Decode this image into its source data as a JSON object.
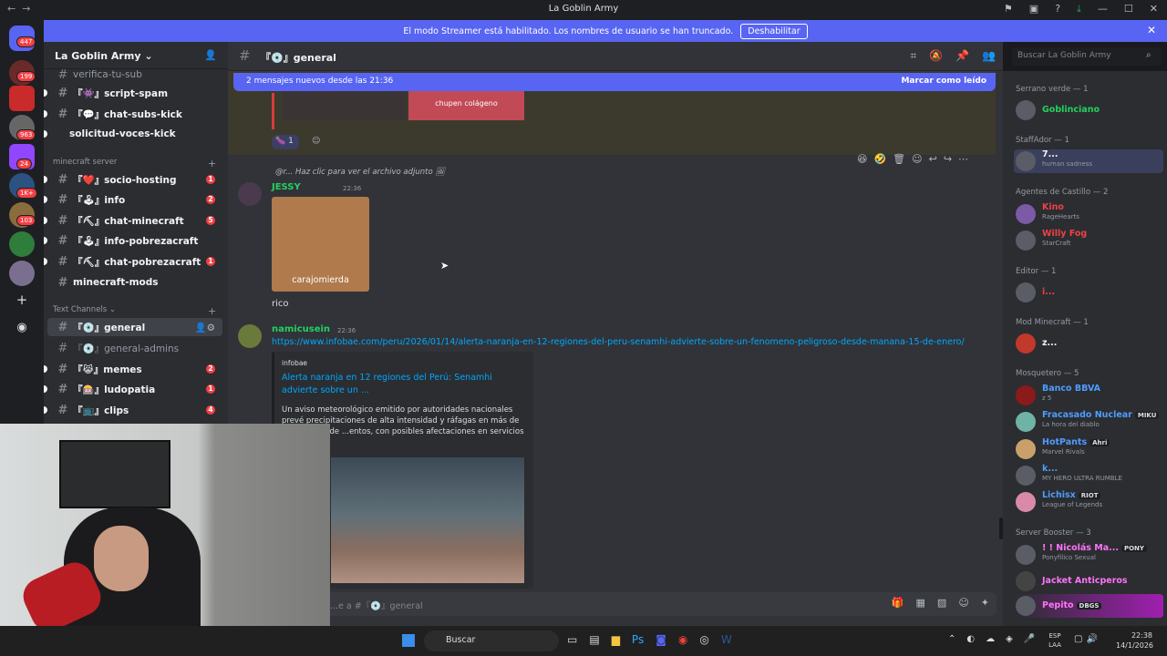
{
  "window": {
    "title": "La Goblin Army"
  },
  "banner": {
    "text": "El modo Streamer está habilitado. Los nombres de usuario se han truncado.",
    "button": "Deshabilitar"
  },
  "server": {
    "name": "La Goblin Army",
    "guild_badges": [
      "447",
      "199",
      "963",
      "24",
      "1K+",
      "103"
    ]
  },
  "channels": [
    {
      "label": "verifica-tu-sub",
      "state": "muted"
    },
    {
      "label": "『👾』script-spam",
      "state": "unread"
    },
    {
      "label": "『💬』chat-subs-kick",
      "state": "unread"
    },
    {
      "label": "solicitud-voces-kick",
      "state": "unread"
    }
  ],
  "categories": {
    "minecraft": "minecraft server",
    "text": "Text Channels"
  },
  "mc_channels": [
    {
      "label": "『❤️』socio-hosting",
      "count": "1"
    },
    {
      "label": "『🕹』info",
      "count": "2"
    },
    {
      "label": "『⛏』chat-minecraft",
      "count": "5"
    },
    {
      "label": "『🕹』info-pobrezacraft",
      "count": ""
    },
    {
      "label": "『⛏』chat-pobrezacraft",
      "count": "1"
    },
    {
      "label": "minecraft-mods",
      "count": ""
    }
  ],
  "text_channels": [
    {
      "label": "『💿』general",
      "count": ""
    },
    {
      "label": "『💿』general-admins",
      "count": ""
    },
    {
      "label": "『😹』memes",
      "count": "2"
    },
    {
      "label": "『🎰』ludopatia",
      "count": "1"
    },
    {
      "label": "『📺』clips",
      "count": "4"
    }
  ],
  "chat": {
    "channel": "『💿』general",
    "search_placeholder": "Buscar La Goblin Army",
    "new_messages": "2 mensajes nuevos desde las 21:36",
    "mark_read": "Marcar como leído",
    "image_caption_prev": "chupen colágeno",
    "reaction_count": "1",
    "reply_preview": "@r... Haz clic para ver el archivo adjunto",
    "msg1": {
      "author": "JESSY",
      "time": "22:36",
      "image_caption": "carajomierda",
      "text": "rico"
    },
    "msg2": {
      "author": "namicusein",
      "time": "22:36",
      "link": "https://www.infobae.com/peru/2026/01/14/alerta-naranja-en-12-regiones-del-peru-senamhi-advierte-sobre-un-fenomeno-peligroso-desde-manana-15-de-enero/",
      "embed_site": "infobae",
      "embed_title": "Alerta naranja en 12 regiones del Perú: Senamhi advierte sobre un ...",
      "embed_desc": "Un aviso meteorológico emitido por autoridades nacionales prevé precipitaciones de alta intensidad y ráfagas en más de una decena de ...entos, con posibles afectaciones en servicios e ...ra"
    },
    "input_placeholder": "...e a #『💿』general"
  },
  "members": {
    "groups": [
      {
        "header": "Serrano verde — 1",
        "members": [
          {
            "name": "Goblinciano",
            "sub": "",
            "color": "#23d160"
          }
        ]
      },
      {
        "header": "StaffAdor — 1",
        "members": [
          {
            "name": "7...",
            "sub": "human sadness",
            "color": "#f2f3f5"
          }
        ]
      },
      {
        "header": "Agentes de Castillo — 2",
        "members": [
          {
            "name": "Kino",
            "sub": "RageHearts",
            "color": "#ed4245"
          },
          {
            "name": "Willy Fog",
            "sub": "StarCraft",
            "color": "#ed4245"
          }
        ]
      },
      {
        "header": "Editor — 1",
        "members": [
          {
            "name": "i...",
            "sub": "",
            "color": "#ed4245"
          }
        ]
      },
      {
        "header": "Mod Minecraft — 1",
        "members": [
          {
            "name": "z...",
            "sub": "",
            "color": "#f2f3f5"
          }
        ]
      },
      {
        "header": "Mosquetero — 5",
        "members": [
          {
            "name": "Banco BBVA",
            "sub": "z 5",
            "color": "#4f9cff"
          },
          {
            "name": "Fracasado Nuclear",
            "sub": "La hora del diablo",
            "color": "#4f9cff",
            "tag": "MIKU"
          },
          {
            "name": "HotPants",
            "sub": "Marvel Rivals",
            "color": "#4f9cff",
            "tag": "Ahri"
          },
          {
            "name": "k...",
            "sub": "MY HERO ULTRA RUMBLE",
            "color": "#4f9cff"
          },
          {
            "name": "Lichisx",
            "sub": "League of Legends",
            "color": "#4f9cff",
            "tag": "RIOT"
          }
        ]
      },
      {
        "header": "Server Booster — 3",
        "members": [
          {
            "name": "! ! Nicolás Ma...",
            "sub": "Ponyfilico Sexual",
            "color": "#ff73fa",
            "tag": "PONY"
          },
          {
            "name": "Jacket Anticperos",
            "sub": "",
            "color": "#ff73fa"
          },
          {
            "name": "Pepito",
            "sub": "",
            "color": "#ff73fa",
            "tag": "DBGS"
          }
        ]
      }
    ]
  },
  "taskbar": {
    "search": "Buscar",
    "lang": "ESP\nLAA",
    "time": "22:38",
    "date": "14/1/2026"
  }
}
